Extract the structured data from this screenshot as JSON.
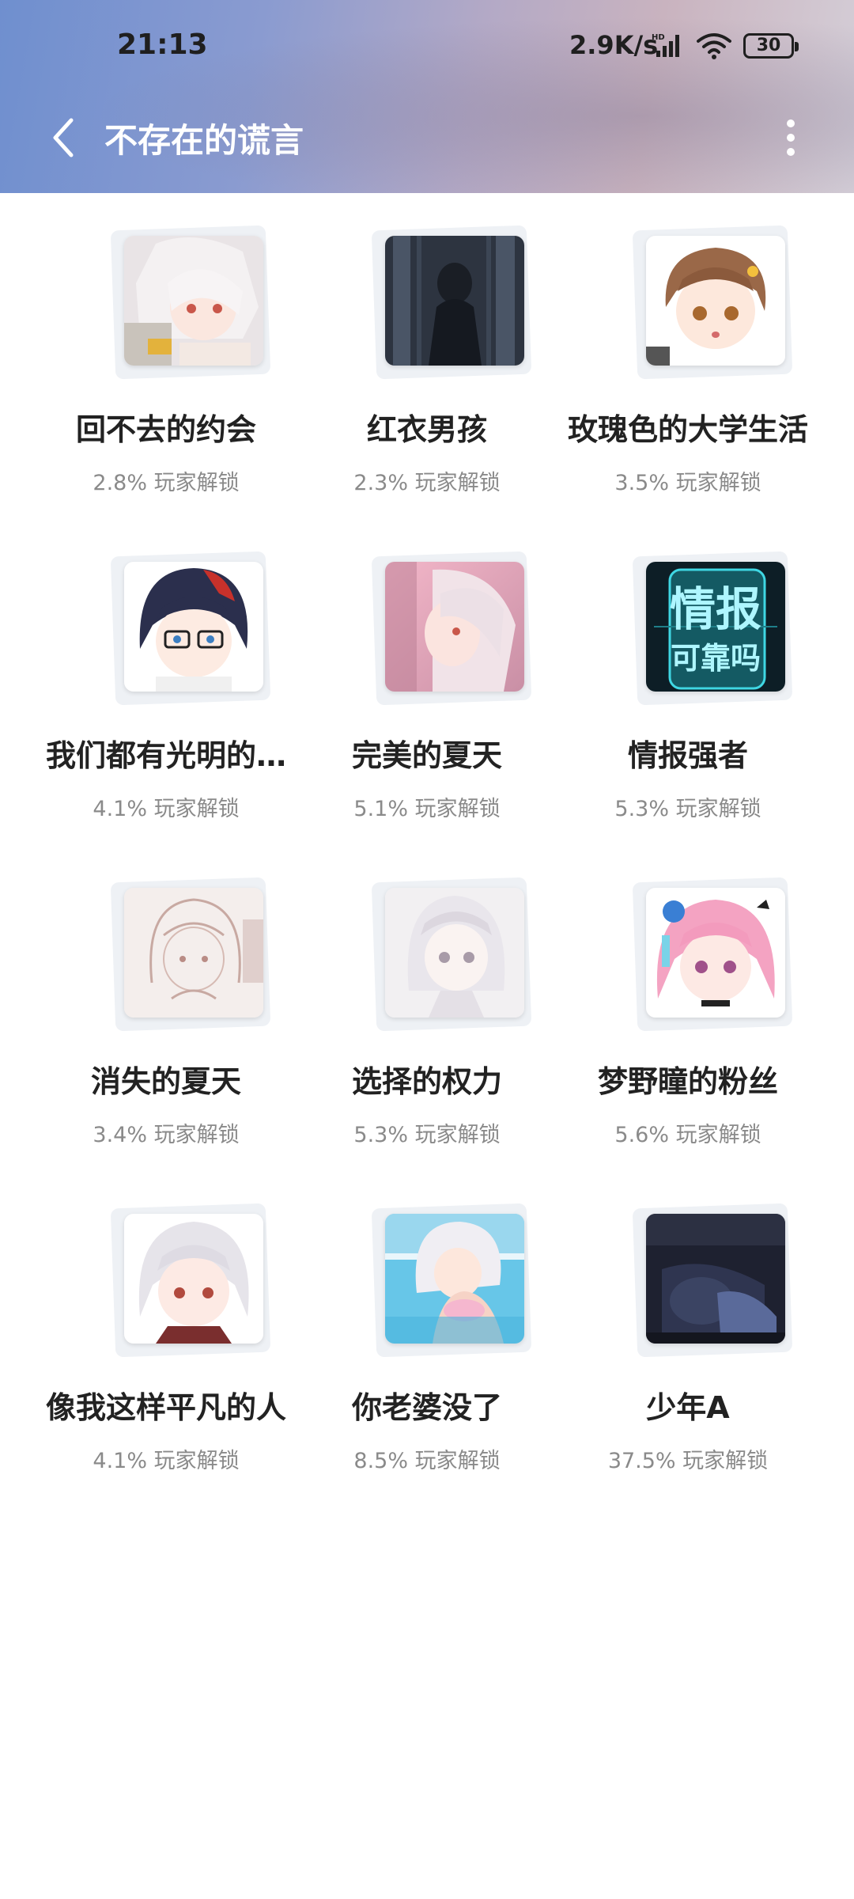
{
  "status": {
    "time": "21:13",
    "net_speed": "2.9K/s",
    "battery": "30"
  },
  "header": {
    "title": "不存在的谎言"
  },
  "achievements": [
    {
      "title": "回不去的约会",
      "unlock": "2.8% 玩家解锁"
    },
    {
      "title": "红衣男孩",
      "unlock": "2.3% 玩家解锁"
    },
    {
      "title": "玫瑰色的大学生活",
      "unlock": "3.5% 玩家解锁"
    },
    {
      "title": "我们都有光明的…",
      "unlock": "4.1% 玩家解锁"
    },
    {
      "title": "完美的夏天",
      "unlock": "5.1% 玩家解锁"
    },
    {
      "title": "情报强者",
      "unlock": "5.3% 玩家解锁",
      "image_text": [
        "情报",
        "可靠吗"
      ]
    },
    {
      "title": "消失的夏天",
      "unlock": "3.4% 玩家解锁"
    },
    {
      "title": "选择的权力",
      "unlock": "5.3% 玩家解锁"
    },
    {
      "title": "梦野瞳的粉丝",
      "unlock": "5.6% 玩家解锁"
    },
    {
      "title": "像我这样平凡的人",
      "unlock": "4.1% 玩家解锁"
    },
    {
      "title": "你老婆没了",
      "unlock": "8.5% 玩家解锁"
    },
    {
      "title": "少年A",
      "unlock": "37.5% 玩家解锁"
    }
  ],
  "icons": {
    "back": "chevron-left-icon",
    "more": "more-vertical-icon",
    "signal": "signal-icon",
    "wifi": "wifi-icon",
    "battery": "battery-icon"
  },
  "colors": {
    "header_gradient_start": "#6f8fcf",
    "header_gradient_end": "#d5cfd8",
    "title_text": "#ffffff",
    "card_title": "#222222",
    "card_sub": "#8a8a8a"
  }
}
